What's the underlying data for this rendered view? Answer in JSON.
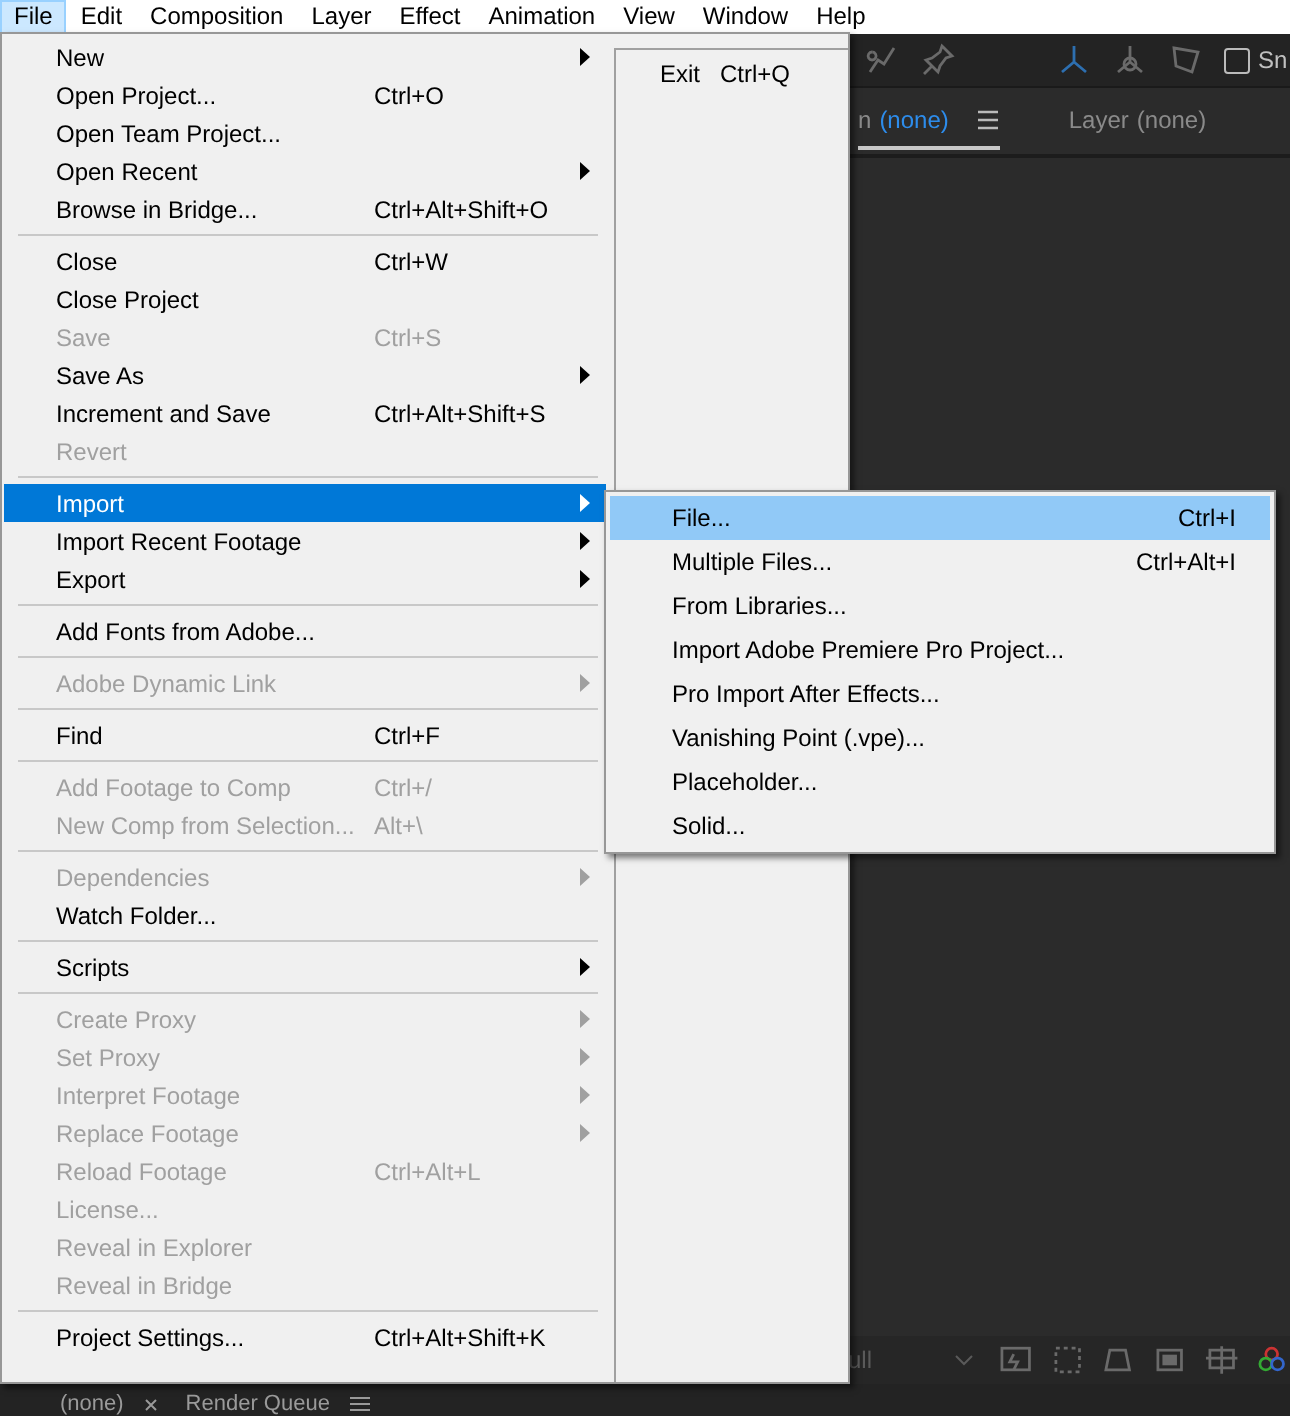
{
  "menubar": [
    {
      "label": "File",
      "selected": true
    },
    {
      "label": "Edit",
      "selected": false
    },
    {
      "label": "Composition",
      "selected": false
    },
    {
      "label": "Layer",
      "selected": false
    },
    {
      "label": "Effect",
      "selected": false
    },
    {
      "label": "Animation",
      "selected": false
    },
    {
      "label": "View",
      "selected": false
    },
    {
      "label": "Window",
      "selected": false
    },
    {
      "label": "Help",
      "selected": false
    }
  ],
  "file_menu": {
    "items": [
      {
        "kind": "item",
        "label": "New",
        "submenu": true,
        "disabled": false,
        "selected": false
      },
      {
        "kind": "item",
        "label": "Open Project...",
        "shortcut": "Ctrl+O",
        "submenu": false,
        "disabled": false,
        "selected": false
      },
      {
        "kind": "item",
        "label": "Open Team Project...",
        "submenu": false,
        "disabled": false,
        "selected": false
      },
      {
        "kind": "item",
        "label": "Open Recent",
        "submenu": true,
        "disabled": false,
        "selected": false
      },
      {
        "kind": "item",
        "label": "Browse in Bridge...",
        "shortcut": "Ctrl+Alt+Shift+O",
        "submenu": false,
        "disabled": false,
        "selected": false
      },
      {
        "kind": "separator"
      },
      {
        "kind": "item",
        "label": "Close",
        "shortcut": "Ctrl+W",
        "submenu": false,
        "disabled": false,
        "selected": false
      },
      {
        "kind": "item",
        "label": "Close Project",
        "submenu": false,
        "disabled": false,
        "selected": false
      },
      {
        "kind": "item",
        "label": "Save",
        "shortcut": "Ctrl+S",
        "submenu": false,
        "disabled": true,
        "selected": false
      },
      {
        "kind": "item",
        "label": "Save As",
        "submenu": true,
        "disabled": false,
        "selected": false
      },
      {
        "kind": "item",
        "label": "Increment and Save",
        "shortcut": "Ctrl+Alt+Shift+S",
        "submenu": false,
        "disabled": false,
        "selected": false
      },
      {
        "kind": "item",
        "label": "Revert",
        "submenu": false,
        "disabled": true,
        "selected": false
      },
      {
        "kind": "separator"
      },
      {
        "kind": "item",
        "label": "Import",
        "submenu": true,
        "disabled": false,
        "selected": true
      },
      {
        "kind": "item",
        "label": "Import Recent Footage",
        "submenu": true,
        "disabled": false,
        "selected": false
      },
      {
        "kind": "item",
        "label": "Export",
        "submenu": true,
        "disabled": false,
        "selected": false
      },
      {
        "kind": "separator"
      },
      {
        "kind": "item",
        "label": "Add Fonts from Adobe...",
        "submenu": false,
        "disabled": false,
        "selected": false
      },
      {
        "kind": "separator"
      },
      {
        "kind": "item",
        "label": "Adobe Dynamic Link",
        "submenu": true,
        "disabled": true,
        "selected": false
      },
      {
        "kind": "separator"
      },
      {
        "kind": "item",
        "label": "Find",
        "shortcut": "Ctrl+F",
        "submenu": false,
        "disabled": false,
        "selected": false
      },
      {
        "kind": "separator"
      },
      {
        "kind": "item",
        "label": "Add Footage to Comp",
        "shortcut": "Ctrl+/",
        "submenu": false,
        "disabled": true,
        "selected": false
      },
      {
        "kind": "item",
        "label": "New Comp from Selection...",
        "shortcut": "Alt+\\",
        "submenu": false,
        "disabled": true,
        "selected": false
      },
      {
        "kind": "separator"
      },
      {
        "kind": "item",
        "label": "Dependencies",
        "submenu": true,
        "disabled": true,
        "selected": false
      },
      {
        "kind": "item",
        "label": "Watch Folder...",
        "submenu": false,
        "disabled": false,
        "selected": false
      },
      {
        "kind": "separator"
      },
      {
        "kind": "item",
        "label": "Scripts",
        "submenu": true,
        "disabled": false,
        "selected": false
      },
      {
        "kind": "separator"
      },
      {
        "kind": "item",
        "label": "Create Proxy",
        "submenu": true,
        "disabled": true,
        "selected": false
      },
      {
        "kind": "item",
        "label": "Set Proxy",
        "submenu": true,
        "disabled": true,
        "selected": false
      },
      {
        "kind": "item",
        "label": "Interpret Footage",
        "submenu": true,
        "disabled": true,
        "selected": false
      },
      {
        "kind": "item",
        "label": "Replace Footage",
        "submenu": true,
        "disabled": true,
        "selected": false
      },
      {
        "kind": "item",
        "label": "Reload Footage",
        "shortcut": "Ctrl+Alt+L",
        "submenu": false,
        "disabled": true,
        "selected": false
      },
      {
        "kind": "item",
        "label": "License...",
        "submenu": false,
        "disabled": true,
        "selected": false
      },
      {
        "kind": "item",
        "label": "Reveal in Explorer",
        "submenu": false,
        "disabled": true,
        "selected": false
      },
      {
        "kind": "item",
        "label": "Reveal in Bridge",
        "submenu": false,
        "disabled": true,
        "selected": false
      },
      {
        "kind": "separator"
      },
      {
        "kind": "item",
        "label": "Project Settings...",
        "shortcut": "Ctrl+Alt+Shift+K",
        "submenu": false,
        "disabled": false,
        "selected": false
      }
    ],
    "column_2": [
      {
        "label": "Exit",
        "shortcut": "Ctrl+Q",
        "selected": false
      }
    ]
  },
  "import_submenu": {
    "items": [
      {
        "label": "File...",
        "shortcut": "Ctrl+I",
        "selected": true
      },
      {
        "label": "Multiple Files...",
        "shortcut": "Ctrl+Alt+I",
        "selected": false
      },
      {
        "label": "From Libraries...",
        "selected": false
      },
      {
        "label": "Import Adobe Premiere Pro Project...",
        "selected": false
      },
      {
        "label": "Pro Import After Effects...",
        "selected": false
      },
      {
        "label": "Vanishing Point (.vpe)...",
        "selected": false
      },
      {
        "label": "Placeholder...",
        "selected": false
      },
      {
        "label": "Solid...",
        "selected": false
      }
    ]
  },
  "app": {
    "toolbar": {
      "checkbox": {
        "label": "Sn",
        "checked": false
      }
    },
    "viewer_tabs": [
      {
        "label": "n",
        "value": "(none)",
        "selected": true
      },
      {
        "label": "Layer",
        "value": "(none)",
        "selected": false
      }
    ],
    "viewer_toolbar": {
      "resolution": "ull"
    },
    "bottom_tabs": [
      {
        "label": "(none)",
        "closable": true
      },
      {
        "label": "Render Queue",
        "closable": false
      }
    ]
  }
}
